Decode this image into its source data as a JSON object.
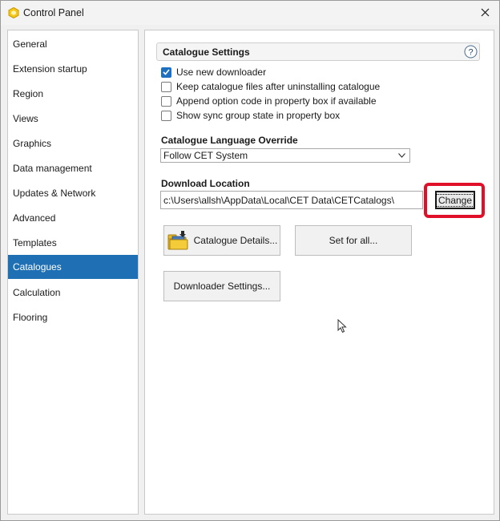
{
  "window": {
    "title": "Control Panel"
  },
  "sidebar": {
    "items": [
      {
        "label": "General"
      },
      {
        "label": "Extension startup"
      },
      {
        "label": "Region"
      },
      {
        "label": "Views"
      },
      {
        "label": "Graphics"
      },
      {
        "label": "Data management"
      },
      {
        "label": "Updates & Network"
      },
      {
        "label": "Advanced"
      },
      {
        "label": "Templates"
      },
      {
        "label": "Catalogues"
      },
      {
        "label": "Calculation"
      },
      {
        "label": "Flooring"
      }
    ],
    "selected": "Catalogues"
  },
  "main": {
    "section_title": "Catalogue Settings",
    "checkboxes": [
      {
        "label": "Use new downloader",
        "checked": true
      },
      {
        "label": "Keep catalogue files after uninstalling catalogue",
        "checked": false
      },
      {
        "label": "Append option code in property box if available",
        "checked": false
      },
      {
        "label": "Show sync group state in property box",
        "checked": false
      }
    ],
    "language": {
      "label": "Catalogue Language Override",
      "selected": "Follow CET System"
    },
    "download": {
      "label": "Download Location",
      "path": "c:\\Users\\allsh\\AppData\\Local\\CET Data\\CETCatalogs\\",
      "change_label": "Change"
    },
    "buttons": {
      "catalogue_details": "Catalogue Details...",
      "set_for_all": "Set for all...",
      "downloader_settings": "Downloader Settings..."
    }
  },
  "colors": {
    "accent": "#1e6fb3",
    "highlight": "#e0102a",
    "checkbox": "#1f6fc1"
  },
  "icons": [
    "app-icon",
    "close-icon",
    "help-icon",
    "chevron-down-icon",
    "catalogue-folder-icon",
    "mouse-cursor-icon"
  ]
}
